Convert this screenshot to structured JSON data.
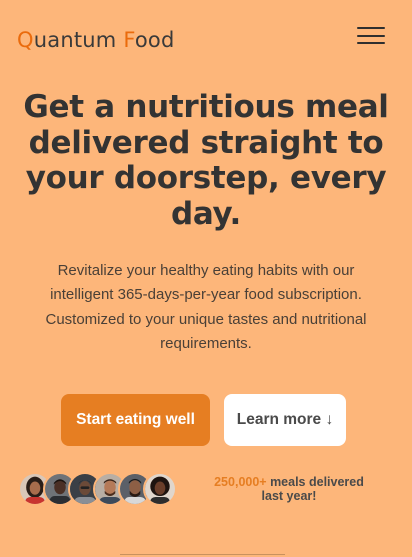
{
  "header": {
    "logo": {
      "q": "Q",
      "uantum": "uantum ",
      "f": "F",
      "ood": "ood"
    },
    "menu_icon": "hamburger-menu-icon"
  },
  "hero": {
    "title_lines": [
      "Get a nutritious meal",
      "delivered straight to",
      "your doorstep, every",
      "day."
    ],
    "text_lines": [
      "Revitalize your healthy eating habits with our",
      "intelligent 365-days-per-year food subscription.",
      "Customized to your unique tastes and nutritional",
      "requirements."
    ],
    "primary_button": "Start eating well",
    "secondary_button": "Learn more ↓"
  },
  "social_proof": {
    "count": "250,000+",
    "line1_rest": " meals delivered",
    "line2": "last year!"
  },
  "colors": {
    "background": "#fdb67a",
    "accent": "#e67e22",
    "logo_accent": "#ea6b0c",
    "text": "#333333"
  }
}
